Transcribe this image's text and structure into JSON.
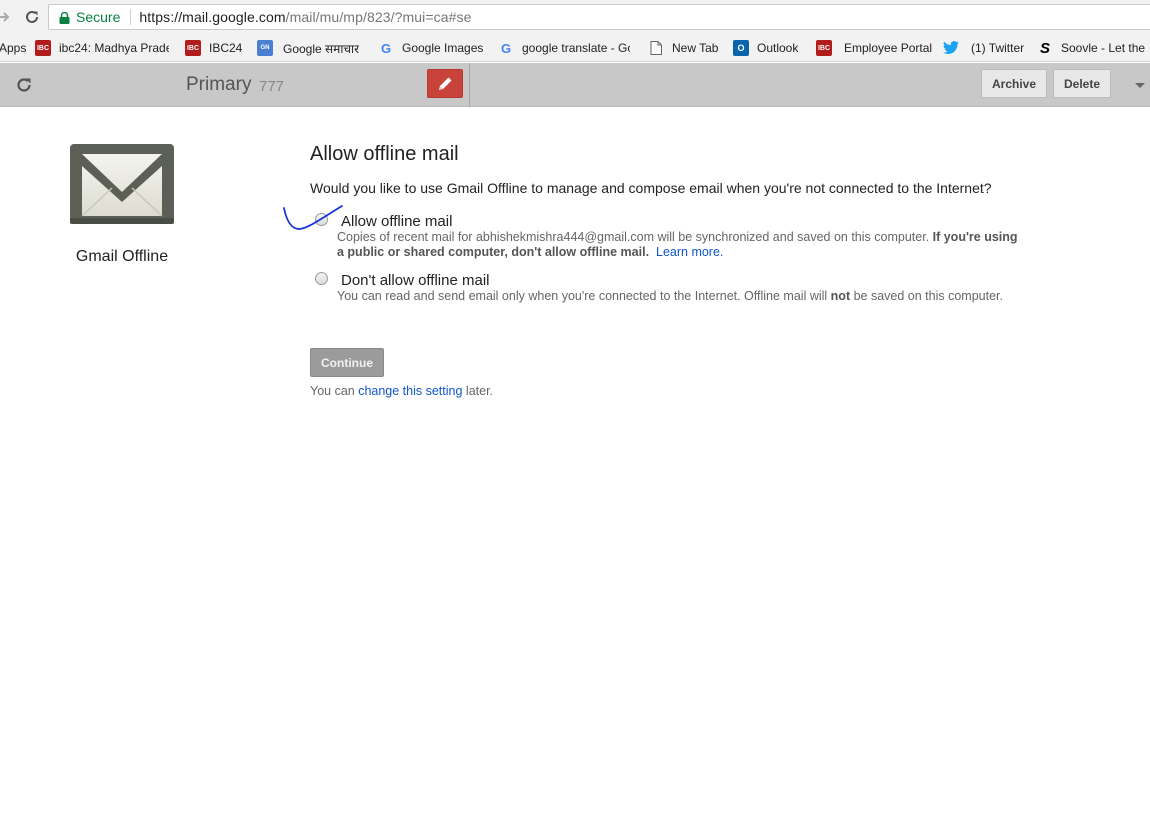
{
  "browser": {
    "security_label": "Secure",
    "url_host": "https://mail.google.com",
    "url_path": "/mail/mu/mp/823/?mui=ca#se",
    "bookmarks": [
      {
        "label": "Apps",
        "icon": "apps-grid-icon"
      },
      {
        "label": "ibc24: Madhya Prade",
        "icon": "ibc24-icon",
        "icon_text": "IBC"
      },
      {
        "label": "IBC24",
        "icon": "ibc24-icon",
        "icon_text": "IBC"
      },
      {
        "label": "Google समाचार",
        "icon": "google-news-icon",
        "icon_text": "GN"
      },
      {
        "label": "Google Images",
        "icon": "google-icon",
        "icon_text": "G"
      },
      {
        "label": "google translate - Go",
        "icon": "google-icon",
        "icon_text": "G"
      },
      {
        "label": "New Tab",
        "icon": "page-icon",
        "icon_text": ""
      },
      {
        "label": "Outlook",
        "icon": "outlook-icon",
        "icon_text": "O"
      },
      {
        "label": "Employee Portal",
        "icon": "ibc24-icon",
        "icon_text": "IBC"
      },
      {
        "label": "(1) Twitter",
        "icon": "twitter-icon",
        "icon_text": "🐦"
      },
      {
        "label": "Soovle - Let the",
        "icon": "soovle-icon",
        "icon_text": "S"
      }
    ]
  },
  "toolbar": {
    "folder_title": "Primary",
    "folder_count": "777",
    "archive_label": "Archive",
    "delete_label": "Delete"
  },
  "sidebar": {
    "logo_caption": "Gmail Offline"
  },
  "offline": {
    "title": "Allow offline mail",
    "question": "Would you like to use Gmail Offline to manage and compose email when you're not connected to the Internet?",
    "option_allow": {
      "label": "Allow offline mail",
      "desc_plain": "Copies of recent mail for abhishekmishra444@gmail.com will be synchronized and saved on this computer. ",
      "desc_bold": "If you're using a public or shared computer, don't allow offline mail.",
      "learn_more": "Learn more."
    },
    "option_deny": {
      "label": "Don't allow offline mail",
      "desc_before": "You can read and send email only when you're connected to the Internet. Offline mail will ",
      "desc_bold": "not",
      "desc_after": " be saved on this computer."
    },
    "continue_label": "Continue",
    "later_before": "You can ",
    "later_link": "change this setting",
    "later_after": " later."
  },
  "colors": {
    "accent_compose": "#c8433a",
    "link": "#1155cc",
    "secure_green": "#0b8043",
    "ink_annotation": "#1a35d8"
  }
}
